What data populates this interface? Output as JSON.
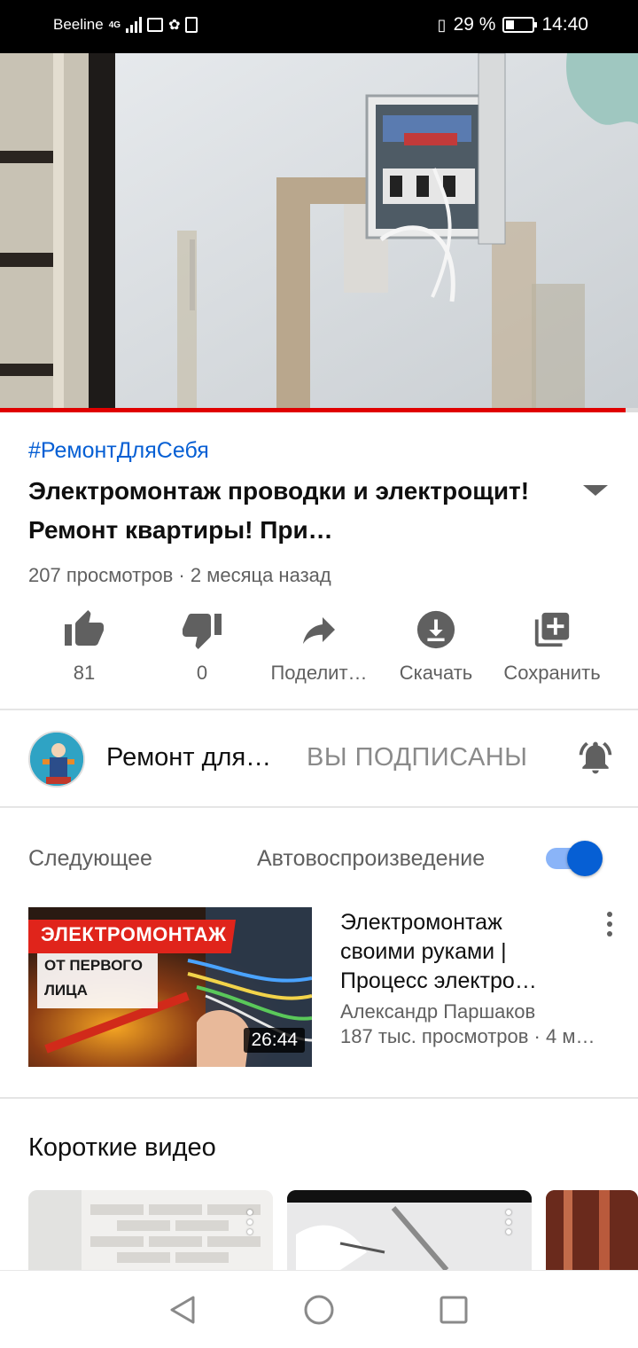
{
  "status_bar": {
    "carrier": "Beeline",
    "network": "4G",
    "battery": "29 %",
    "battery_level": 0.29,
    "time": "14:40"
  },
  "player": {
    "progress": 0.98
  },
  "video": {
    "hashtag": "#РемонтДляСебя",
    "title": "Электромонтаж проводки и электрощит! Ремонт квартиры! При…",
    "meta": "207 просмотров · 2 месяца назад"
  },
  "actions": {
    "like_count": "81",
    "dislike_count": "0",
    "share_label": "Поделит…",
    "download_label": "Скачать",
    "save_label": "Сохранить"
  },
  "channel": {
    "name": "Ремонт для…",
    "subscribe_state": "ВЫ ПОДПИСАНЫ"
  },
  "up_next": {
    "label": "Следующее",
    "autoplay_label": "Автовоспроизведение",
    "autoplay_on": true
  },
  "recommendation": {
    "thumb_line1": "ЭЛЕКТРОМОНТАЖ",
    "thumb_line2": "ОТ ПЕРВОГО",
    "thumb_line3": "ЛИЦА",
    "duration": "26:44",
    "title": "Электромонтаж своими руками | Процесс электро…",
    "channel": "Александр Паршаков",
    "stats": "187 тыс. просмотров · 4 м…"
  },
  "shorts": {
    "title": "Короткие видео"
  },
  "icons": {
    "like": "thumb-up-icon",
    "dislike": "thumb-down-icon",
    "share": "share-arrow-icon",
    "download": "download-icon",
    "save": "playlist-add-icon",
    "bell": "bell-ring-icon",
    "menu": "more-vert-icon",
    "nav_back": "triangle-back-icon",
    "nav_home": "circle-home-icon",
    "nav_recents": "square-recents-icon"
  },
  "colors": {
    "accent_blue": "#065fd4",
    "progress_red": "#e00000",
    "secondary_text": "#606060"
  }
}
